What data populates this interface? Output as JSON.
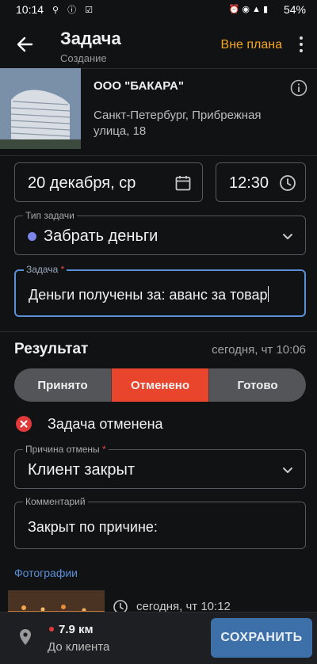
{
  "status_bar": {
    "time": "10:14",
    "battery": "54%",
    "network": "LTE1"
  },
  "app_bar": {
    "title": "Задача",
    "subtitle": "Создание",
    "off_plan": "Вне плана",
    "accent_color": "#f5a623"
  },
  "client": {
    "name": "ООО \"БАКАРА\"",
    "address": "Санкт-Петербург,  Прибрежная улица, 18"
  },
  "schedule": {
    "date": "20 декабря, ср",
    "time": "12:30"
  },
  "task_type": {
    "label": "Тип задачи",
    "value": "Забрать деньги",
    "dot_color": "#7b86e8"
  },
  "task": {
    "label": "Задача",
    "required_mark": "*",
    "value": "Деньги получены за: аванс за товар"
  },
  "result": {
    "title": "Результат",
    "timestamp": "сегодня, чт 10:06",
    "options": [
      "Принято",
      "Отменено",
      "Готово"
    ],
    "selected": "Отменено",
    "selected_color": "#e8452c",
    "status_text": "Задача отменена"
  },
  "cancel_reason": {
    "label": "Причина отмены",
    "required_mark": "*",
    "value": "Клиент закрыт"
  },
  "comment": {
    "label": "Комментарий",
    "value": "Закрыт по причине:"
  },
  "photos": {
    "label": "Фотографии",
    "items": [
      {
        "date": "сегодня, чт 10:12"
      }
    ]
  },
  "bottom_bar": {
    "distance": "7.9 км",
    "distance_label": "До клиента",
    "save_label": "СОХРАНИТЬ",
    "save_color": "#3d6fa8"
  }
}
